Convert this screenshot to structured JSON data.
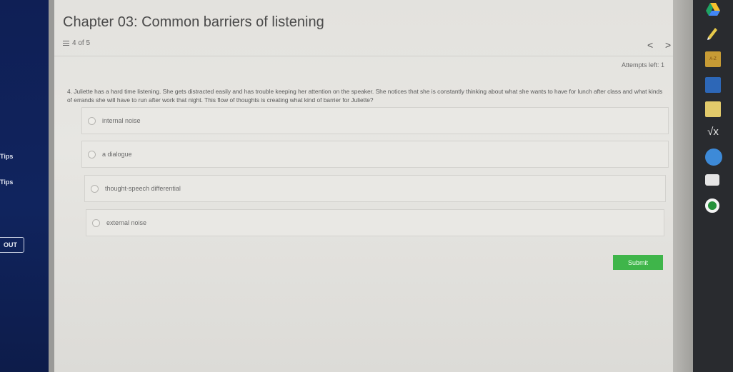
{
  "sidebar": {
    "items": [
      "Tips",
      "Tips"
    ],
    "logout_label": "OUT"
  },
  "header": {
    "chapter_title": "Chapter 03: Common barriers of listening",
    "page_indicator": "4 of 5",
    "prev_symbol": "<",
    "next_symbol": ">",
    "attempts_left": "Attempts left: 1"
  },
  "question": {
    "text": "4. Juliette has a hard time listening. She gets distracted easily and has trouble keeping her attention on the speaker. She notices that she is constantly thinking about what she wants to have for lunch after class and what kinds of errands she will have to run after work that night. This flow of thoughts is creating what kind of barrier for Juliette?",
    "options": [
      {
        "label": "internal noise"
      },
      {
        "label": "a dialogue"
      },
      {
        "label": "thought-speech differential"
      },
      {
        "label": "external noise"
      }
    ]
  },
  "actions": {
    "submit_label": "Submit"
  },
  "right_bar": {
    "az_label": "A-Z",
    "formula_symbol": "√x"
  },
  "colors": {
    "sidebar_bg": "#10245e",
    "submit_bg": "#3fb54a",
    "content_bg": "#e5e4e0"
  }
}
